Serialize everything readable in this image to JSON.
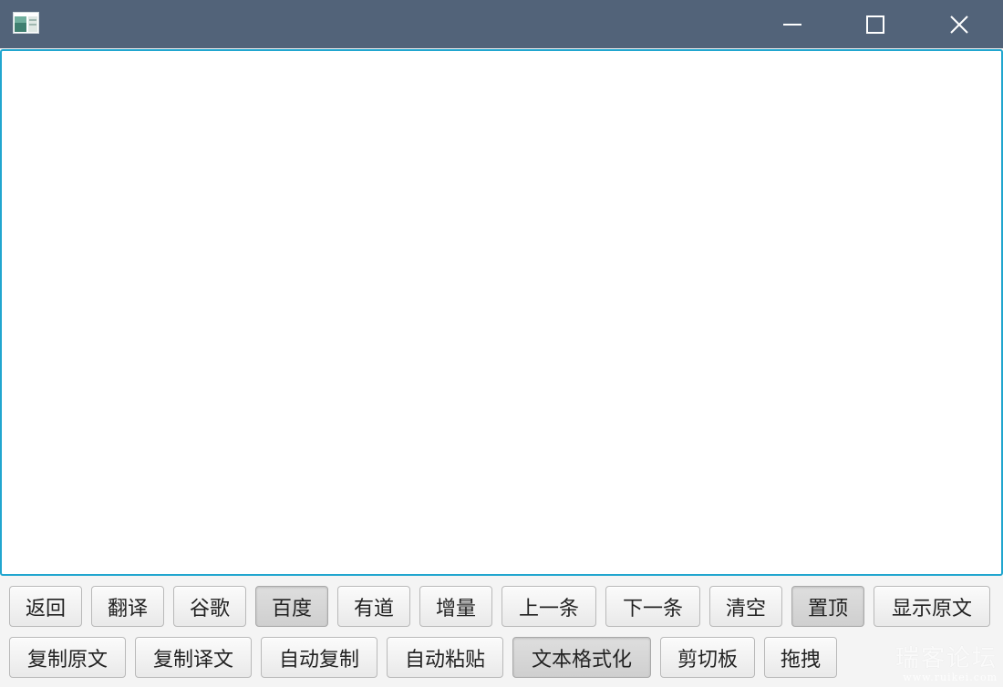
{
  "window": {
    "title": ""
  },
  "editor": {
    "value": ""
  },
  "row1": [
    {
      "label": "返回",
      "pressed": false
    },
    {
      "label": "翻译",
      "pressed": false
    },
    {
      "label": "谷歌",
      "pressed": false
    },
    {
      "label": "百度",
      "pressed": true
    },
    {
      "label": "有道",
      "pressed": false
    },
    {
      "label": "增量",
      "pressed": false
    },
    {
      "label": "上一条",
      "pressed": false
    },
    {
      "label": "下一条",
      "pressed": false
    },
    {
      "label": "清空",
      "pressed": false
    },
    {
      "label": "置顶",
      "pressed": true
    },
    {
      "label": "显示原文",
      "pressed": false
    }
  ],
  "row2": [
    {
      "label": "复制原文",
      "pressed": false
    },
    {
      "label": "复制译文",
      "pressed": false
    },
    {
      "label": "自动复制",
      "pressed": false
    },
    {
      "label": "自动粘贴",
      "pressed": false
    },
    {
      "label": "文本格式化",
      "pressed": true
    },
    {
      "label": "剪切板",
      "pressed": false
    },
    {
      "label": "拖拽",
      "pressed": false
    }
  ],
  "watermark": {
    "main": "瑞客论坛",
    "url": "www.ruikei.com"
  },
  "colors": {
    "titlebar": "#526379",
    "focus_border": "#21a6cf",
    "background": "#f4f4f4"
  },
  "icons": [
    "app-icon",
    "minimize-icon",
    "maximize-icon",
    "close-icon"
  ]
}
